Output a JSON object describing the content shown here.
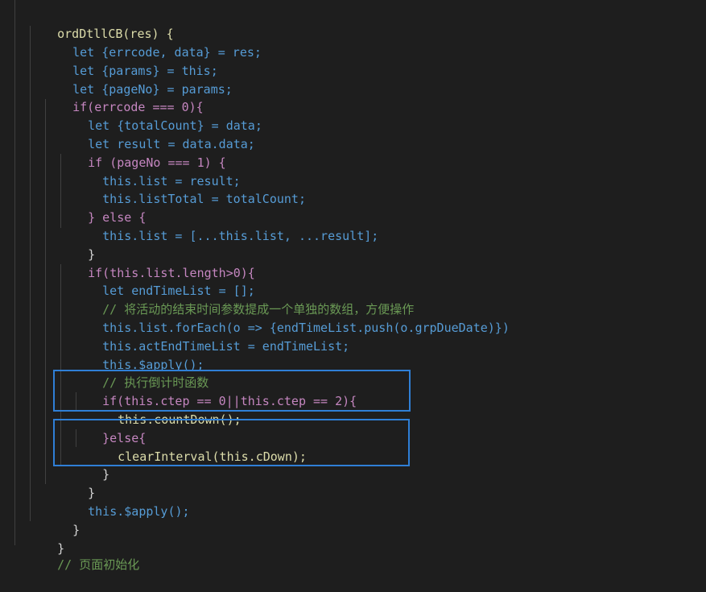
{
  "theme": {
    "background": "#1e1e1e",
    "keyword": "#569cd6",
    "control": "#c586c0",
    "function": "#dcdcaa",
    "variable": "#9cdcfe",
    "number": "#b5cea8",
    "comment": "#6a9955",
    "highlight_box": "#2f7fd6"
  },
  "code": {
    "l0": "ordDtllCB(res) {",
    "l1": "let {errcode, data} = res;",
    "l2": "let {params} = this;",
    "l3": "let {pageNo} = params;",
    "l4": "if(errcode === 0){",
    "l5": "let {totalCount} = data;",
    "l6": "let result = data.data;",
    "l7": "if (pageNo === 1) {",
    "l8": "this.list = result;",
    "l9": "this.listTotal = totalCount;",
    "l10": "} else {",
    "l11": "this.list = [...this.list, ...result];",
    "l12": "}",
    "l13": "if(this.list.length>0){",
    "l14": "let endTimeList = [];",
    "l15": "// 将活动的结束时间参数提成一个单独的数组，方便操作",
    "l16": "this.list.forEach(o => {endTimeList.push(o.grpDueDate)})",
    "l17": "this.actEndTimeList = endTimeList;",
    "l18": "this.$apply();",
    "l19": "// 执行倒计时函数",
    "l20": "if(this.ctep == 0||this.ctep == 2){",
    "l21": "this.countDown();",
    "l22": "}else{",
    "l23": "clearInterval(this.cDown);",
    "l24": "}",
    "l25": "}",
    "l26": "this.$apply();",
    "l27": "}",
    "l28": "}",
    "l29": "// 页面初始化"
  }
}
